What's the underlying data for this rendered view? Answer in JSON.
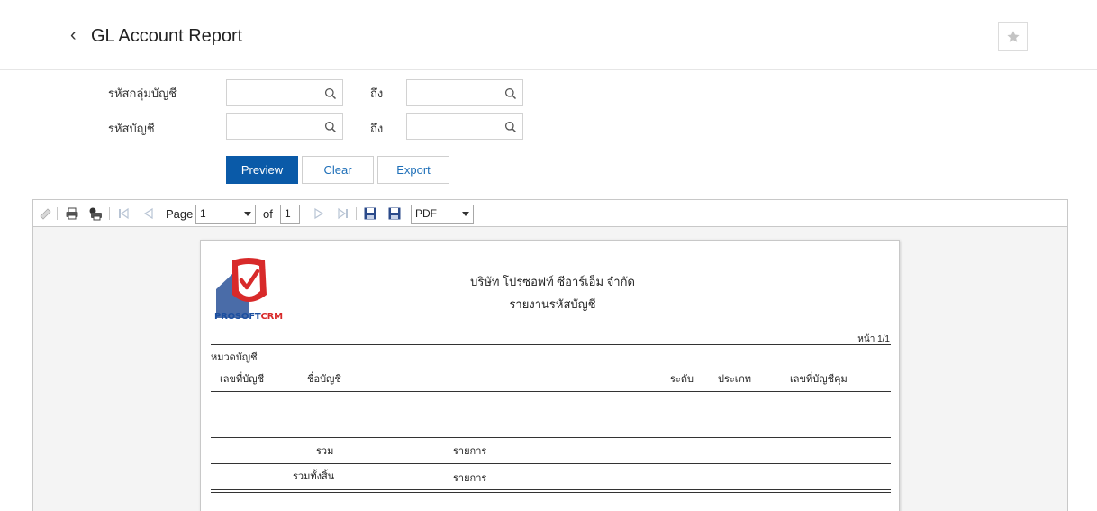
{
  "header": {
    "title": "GL Account Report",
    "back_icon": "chevron-left-icon",
    "favorite_icon": "star-icon"
  },
  "filters": {
    "group_code_label": "รหัสกลุ่มบัญชี",
    "account_code_label": "รหัสบัญชี",
    "to_label": "ถึง",
    "group_code_from": "",
    "group_code_to": "",
    "account_code_from": "",
    "account_code_to": ""
  },
  "actions": {
    "preview": "Preview",
    "clear": "Clear",
    "export": "Export"
  },
  "toolbar": {
    "page_label": "Page",
    "page_value": "1",
    "of_label": "of",
    "total_pages": "1",
    "export_format": "PDF"
  },
  "report": {
    "company": "บริษัท โปรซอฟท์ ซีอาร์เอ็ม จำกัด",
    "title": "รายงานรหัสบัญชี",
    "logo_text_pro": "PROSOFT",
    "logo_text_crm": "CRM",
    "page_label": "หน้า 1/1",
    "category_label": "หมวดบัญชี",
    "columns": [
      "เลขที่บัญชี",
      "ชื่อบัญชี",
      "ระดับ",
      "ประเภท",
      "เลขที่บัญชีคุม"
    ],
    "subtotal_label": "รวม",
    "subtotal_unit": "รายการ",
    "grand_total_label": "รวมทั้งสิ้น",
    "grand_total_unit": "รายการ"
  },
  "colors": {
    "primary": "#0a5aa8",
    "link": "#1e6fb8",
    "logo_red": "#d82a2a",
    "logo_blue": "#1c4fa0"
  }
}
